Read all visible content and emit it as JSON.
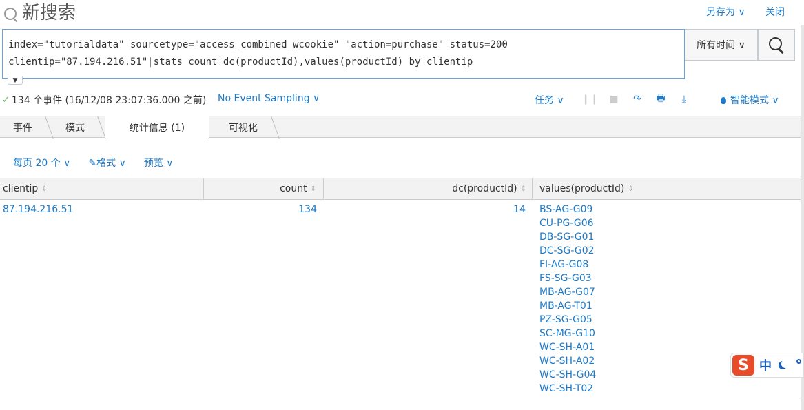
{
  "header": {
    "title": "新搜索",
    "save_as": "另存为 ∨",
    "close": "关闭"
  },
  "search": {
    "query_line1": "index=\"tutorialdata\" sourcetype=\"access_combined_wcookie\" \"action=purchase\" status=200",
    "query_line2_a": "clientip=\"87.194.216.51\"",
    "query_pipe": "|",
    "query_line2_b": "stats count dc(productId),values(productId) by clientip",
    "time_range": "所有时间 ∨"
  },
  "status": {
    "events": "134 个事件 (16/12/08 23:07:36.000 之前)",
    "sampling": "No Event Sampling ∨",
    "job": "任务 ∨",
    "smart_mode": "智能模式 ∨"
  },
  "tabs": [
    "事件",
    "模式",
    "统计信息 (1)",
    "可视化"
  ],
  "controls": {
    "per_page": "每页 20 个 ∨",
    "format": "✎格式 ∨",
    "preview": "预览 ∨"
  },
  "table": {
    "columns": [
      "clientip",
      "count",
      "dc(productId)",
      "values(productId)"
    ],
    "row": {
      "clientip": "87.194.216.51",
      "count": "134",
      "dc": "14",
      "values": [
        "BS-AG-G09",
        "CU-PG-G06",
        "DB-SG-G01",
        "DC-SG-G02",
        "FI-AG-G08",
        "FS-SG-G03",
        "MB-AG-G07",
        "MB-AG-T01",
        "PZ-SG-G05",
        "SC-MG-G10",
        "WC-SH-A01",
        "WC-SH-A02",
        "WC-SH-G04",
        "WC-SH-T02"
      ]
    }
  },
  "ime": {
    "logo": "S",
    "lang": "中"
  },
  "colors": {
    "link": "#1e7ac7",
    "ime_red": "#e84b2a",
    "ime_blue": "#1e5fb8"
  }
}
